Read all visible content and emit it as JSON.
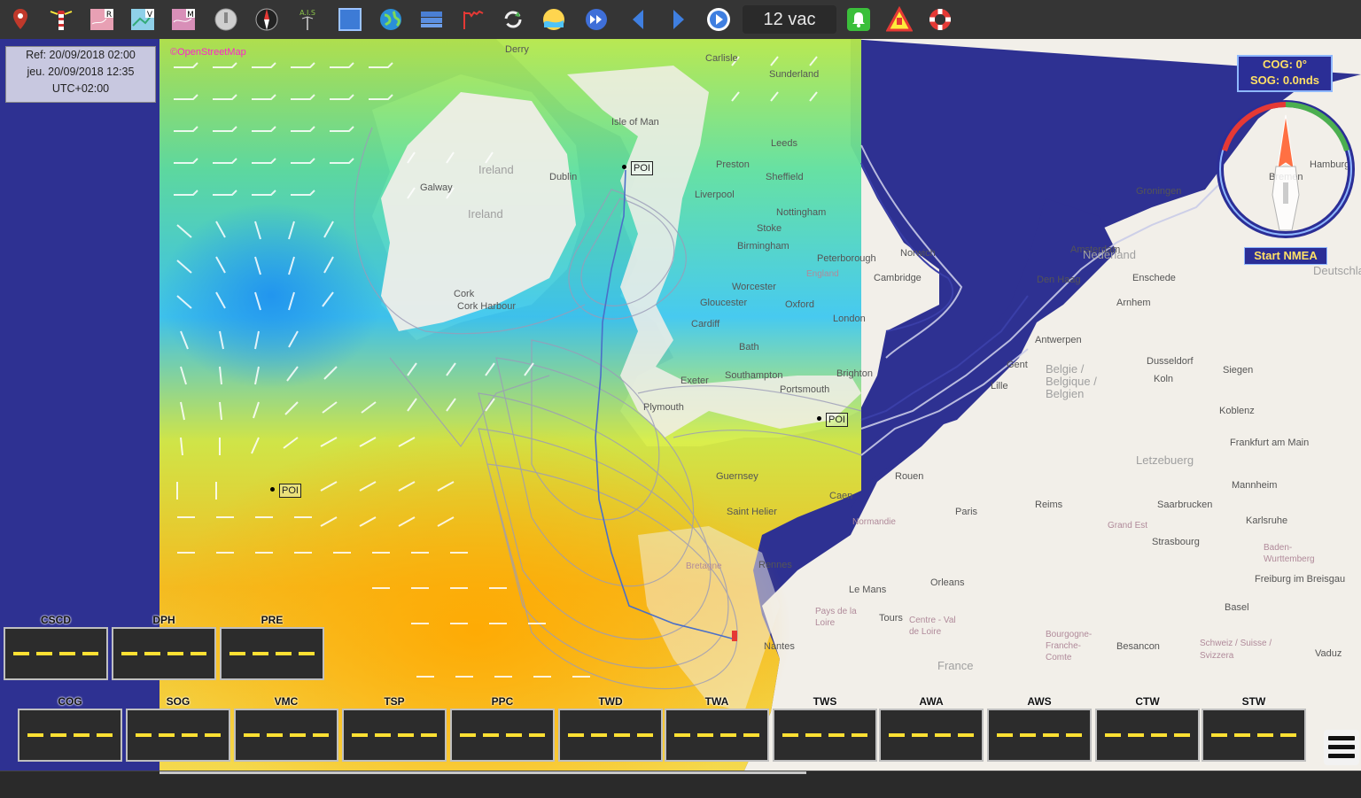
{
  "toolbar": {
    "icons": [
      "map-pin-icon",
      "lighthouse-icon",
      "raster-chart-icon",
      "vector-chart-icon",
      "marine-chart-icon",
      "record-icon",
      "compass-rose-icon",
      "ais-icon",
      "square-layer-icon",
      "globe-icon",
      "layers-icon",
      "barograph-icon",
      "sync-icon",
      "weather-icon",
      "fast-forward-icon",
      "previous-icon",
      "next-icon",
      "play-icon",
      "alarm-bell-icon",
      "warning-icon",
      "lifebuoy-icon"
    ],
    "ais_label": "A.I.S",
    "engine_label": "12 vac",
    "colors": {
      "bar": "#353535",
      "alarm": "#3bbf3b",
      "warning": "#e53935"
    }
  },
  "info": {
    "ref": "Ref: 20/09/2018 02:00",
    "valid": "jeu. 20/09/2018 12:35",
    "tz": "UTC+02:00"
  },
  "grib_source": "©OpenStreetMap",
  "gps": {
    "cog": "COG: 0°",
    "sog": "SOG: 0.0nds",
    "start": "Start NMEA"
  },
  "poi_label": "POI",
  "map_labels": {
    "cities": [
      "Derry",
      "Carlisle",
      "Isle of Man",
      "Leeds",
      "Preston",
      "Sheffield",
      "Liverpool",
      "Dublin",
      "Nottingham",
      "Birmingham",
      "Peterborough",
      "Norwich",
      "Cambridge",
      "Worcester",
      "Gloucester",
      "Oxford",
      "London",
      "Cardiff",
      "Bath",
      "Exeter",
      "Southampton",
      "Portsmouth",
      "Brighton",
      "Plymouth",
      "Guernsey",
      "Saint Helier",
      "Rennes",
      "Nantes",
      "Le Mans",
      "Tours",
      "Orleans",
      "Paris",
      "Rouen",
      "Reims",
      "Caen",
      "Groningen",
      "Amsterdam",
      "Den Haag",
      "Enschede",
      "Arnhem",
      "Antwerpen",
      "Gent",
      "Lille",
      "Dusseldorf",
      "Koln",
      "Siegen",
      "Frankfurt am Main",
      "Koblenz",
      "Mannheim",
      "Saarbrucken",
      "Karlsruhe",
      "Strasbourg",
      "Freiburg im Breisgau",
      "Basel",
      "Besancon",
      "Vaduz",
      "Hamburg",
      "Bremen",
      "Galway",
      "Cork",
      "Cork Harbour",
      "Sunderland",
      "Stoke"
    ],
    "countries": [
      "Ireland",
      "Ireland",
      "England",
      "Nederland",
      "Belgie / Belgique / Belgien",
      "Letzebuerg",
      "France",
      "Deutschland",
      "Schweiz / Suisse / Svizzera",
      "Bretagne",
      "Pays de la Loire",
      "Normandie",
      "Grand Est",
      "Centre - Val de Loire",
      "Bourgogne-Franche-Comte",
      "Baden-Wurttemberg"
    ]
  },
  "instruments": {
    "top": [
      {
        "label": "CSCD"
      },
      {
        "label": "DPH"
      },
      {
        "label": "PRE"
      }
    ],
    "bottom": [
      {
        "label": "COG"
      },
      {
        "label": "SOG"
      },
      {
        "label": "VMC"
      },
      {
        "label": "TSP"
      },
      {
        "label": "PPC"
      },
      {
        "label": "TWD"
      },
      {
        "label": "TWA"
      },
      {
        "label": "TWS"
      },
      {
        "label": "AWA"
      },
      {
        "label": "AWS"
      },
      {
        "label": "CTW"
      },
      {
        "label": "STW"
      }
    ],
    "colors": {
      "box": "#2c2c2c",
      "border": "#bfbfbf",
      "dash": "#ffe033"
    }
  },
  "menu": {
    "icon": "menu-icon"
  },
  "map_colors": {
    "sea": "#2e3192",
    "land": "#f2efe9",
    "wind_low": "#22b8f2",
    "wind_mid": "#ffe400",
    "wind_high": "#ffb000"
  }
}
